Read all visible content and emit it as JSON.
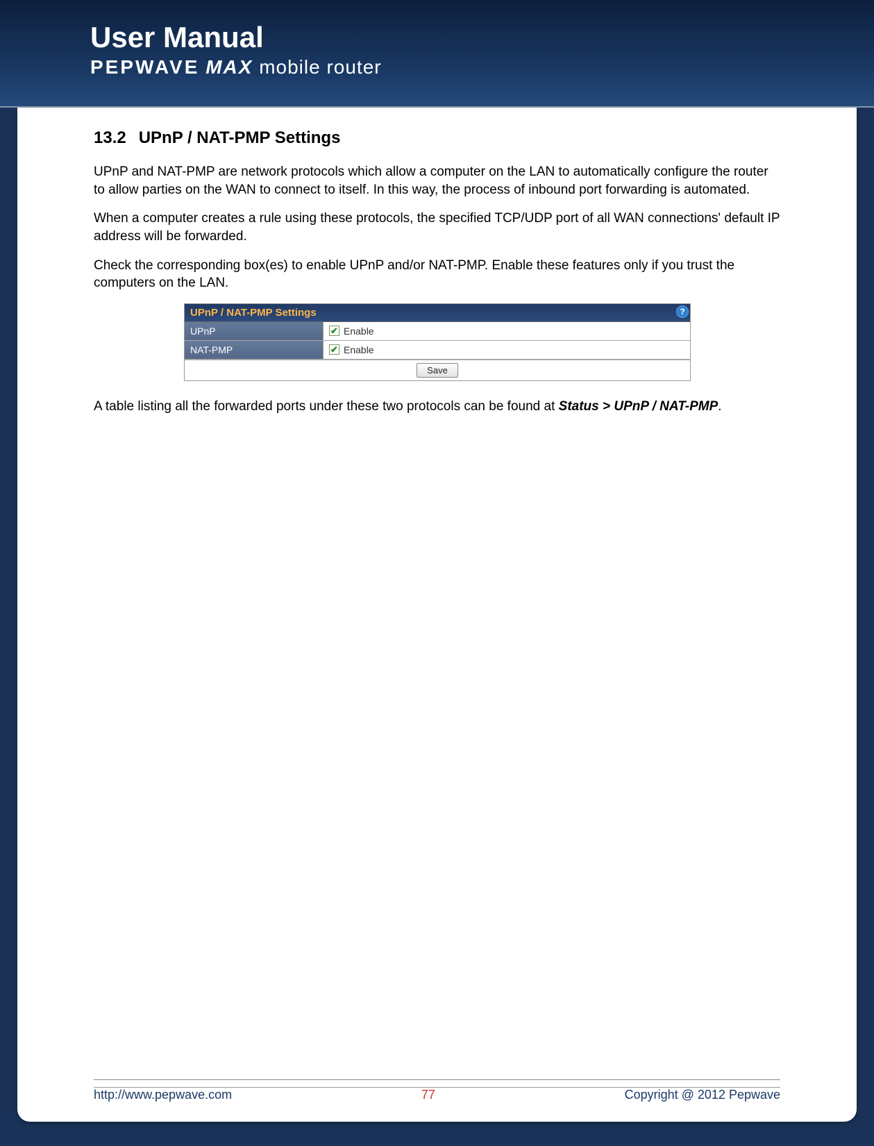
{
  "header": {
    "title": "User Manual",
    "brand1": "PEPWAVE",
    "brand2": "MAX",
    "brand3": "mobile router"
  },
  "section": {
    "number": "13.2",
    "title": "UPnP / NAT-PMP Settings"
  },
  "paragraphs": {
    "p1": "UPnP and NAT-PMP are network protocols which allow a computer on the LAN to automatically configure the router to allow parties on the WAN to connect to itself. In this way, the process of inbound port forwarding is automated.",
    "p2": "When a computer creates a rule using these protocols, the specified TCP/UDP port of all WAN connections' default IP address will be forwarded.",
    "p3": "Check the corresponding box(es) to enable UPnP and/or NAT-PMP. Enable these features only if you trust the computers on the LAN.",
    "p4a": "A table listing all the forwarded ports under these two protocols can be found at ",
    "p4b": "Status > UPnP / NAT-PMP",
    "p4c": "."
  },
  "settings": {
    "panel_title": "UPnP / NAT-PMP Settings",
    "help_symbol": "?",
    "rows": [
      {
        "label": "UPnP",
        "checked": true,
        "text": "Enable"
      },
      {
        "label": "NAT-PMP",
        "checked": true,
        "text": "Enable"
      }
    ],
    "save_label": "Save"
  },
  "footer": {
    "url": "http://www.pepwave.com",
    "page": "77",
    "copyright": "Copyright @ 2012 Pepwave"
  }
}
